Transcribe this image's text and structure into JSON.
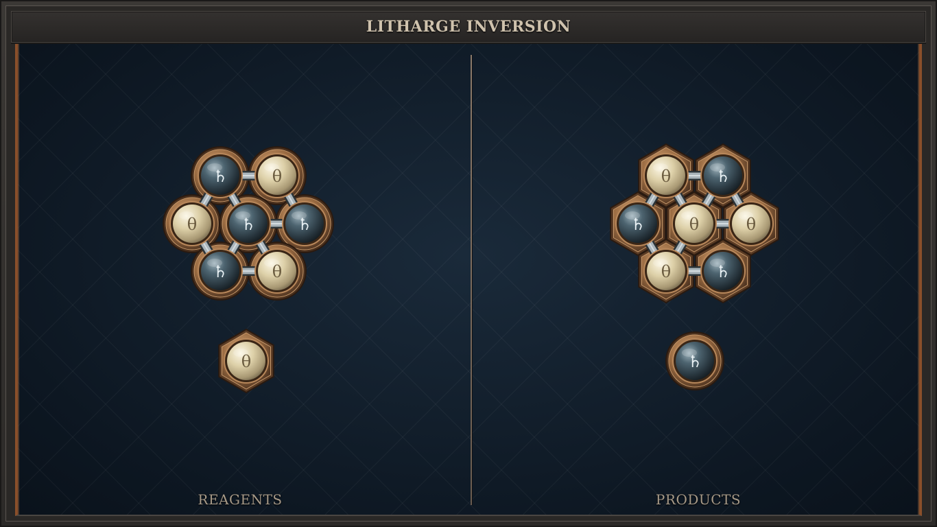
{
  "title": "LITHARGE INVERSION",
  "panels": {
    "reagents_label": "REAGENTS",
    "products_label": "PRODUCTS"
  },
  "atom_types": {
    "lead": {
      "symbol": "♄",
      "color": "#3a4e58",
      "glyph_color": "#eaf2f5"
    },
    "salt": {
      "symbol": "θ",
      "color": "#e2d6b2",
      "glyph_color": "#6b5c40"
    }
  },
  "reagents": [
    {
      "name": "reagent-molecule-1",
      "atoms": [
        "lead",
        "salt",
        "salt",
        "lead",
        "lead",
        "lead",
        "salt"
      ],
      "bonds": 9
    },
    {
      "name": "reagent-molecule-2",
      "atoms": [
        "salt"
      ],
      "bonds": 0
    }
  ],
  "products": [
    {
      "name": "product-molecule-1",
      "atoms": [
        "salt",
        "lead",
        "lead",
        "salt",
        "salt",
        "salt",
        "lead"
      ],
      "bonds": 9
    },
    {
      "name": "product-molecule-2",
      "atoms": [
        "lead"
      ],
      "bonds": 0
    }
  ]
}
